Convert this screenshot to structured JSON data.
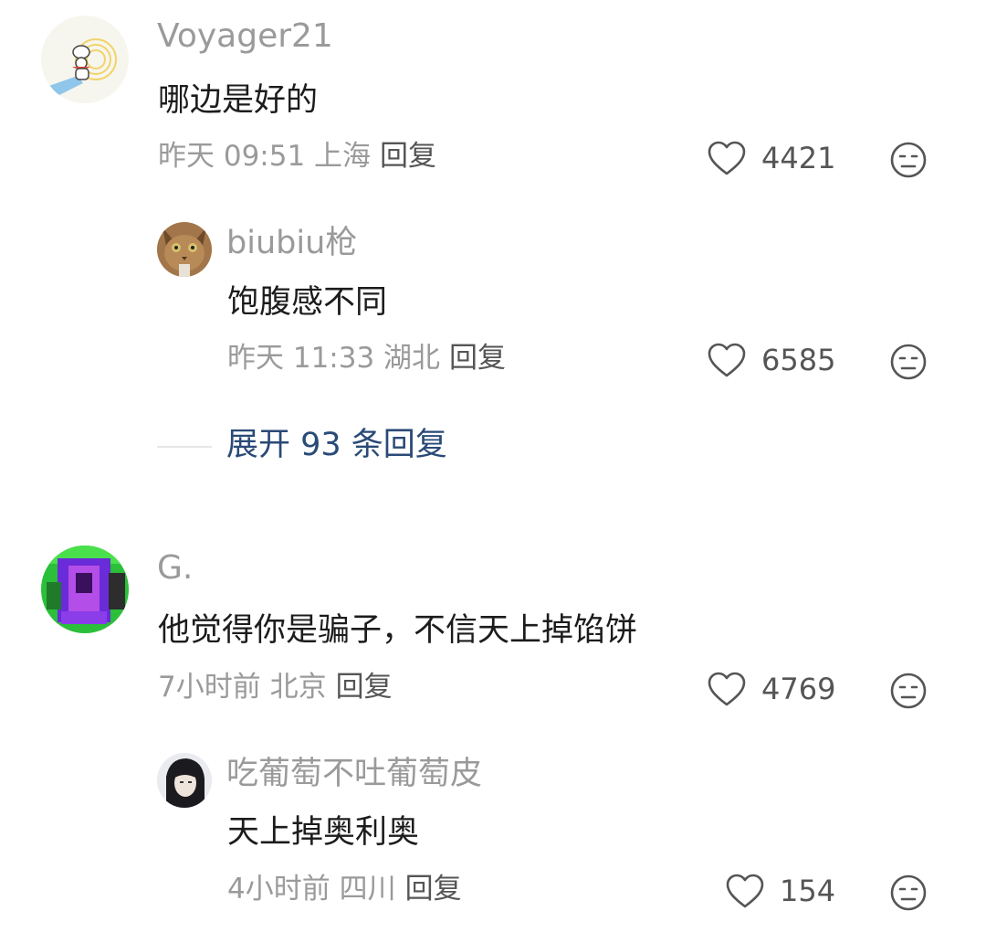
{
  "comments": [
    {
      "user": "Voyager21",
      "text": "哪边是好的",
      "meta": "昨天 09:51 上海",
      "reply_label": "回复",
      "likes": "4421",
      "avatar_icon": "chef-illustration-icon",
      "replies": [
        {
          "user": "biubiu枪",
          "text": "饱腹感不同",
          "meta": "昨天 11:33 湖北",
          "reply_label": "回复",
          "likes": "6585",
          "avatar_icon": "cat-photo-icon"
        }
      ],
      "expand_label": "展开 93 条回复"
    },
    {
      "user": "G.",
      "text": "他觉得你是骗子，不信天上掉馅饼",
      "meta": "7小时前 北京",
      "reply_label": "回复",
      "likes": "4769",
      "avatar_icon": "glitch-art-icon",
      "replies": [
        {
          "user": "吃葡萄不吐葡萄皮",
          "text": "天上掉奥利奥",
          "meta": "4小时前 四川",
          "reply_label": "回复",
          "likes": "154",
          "avatar_icon": "girl-photo-icon"
        }
      ]
    }
  ],
  "colors": {
    "username": "#9a9a9a",
    "body_text": "#1c1c1c",
    "meta": "#9a9a9a",
    "expand_link": "#2a4a77"
  }
}
